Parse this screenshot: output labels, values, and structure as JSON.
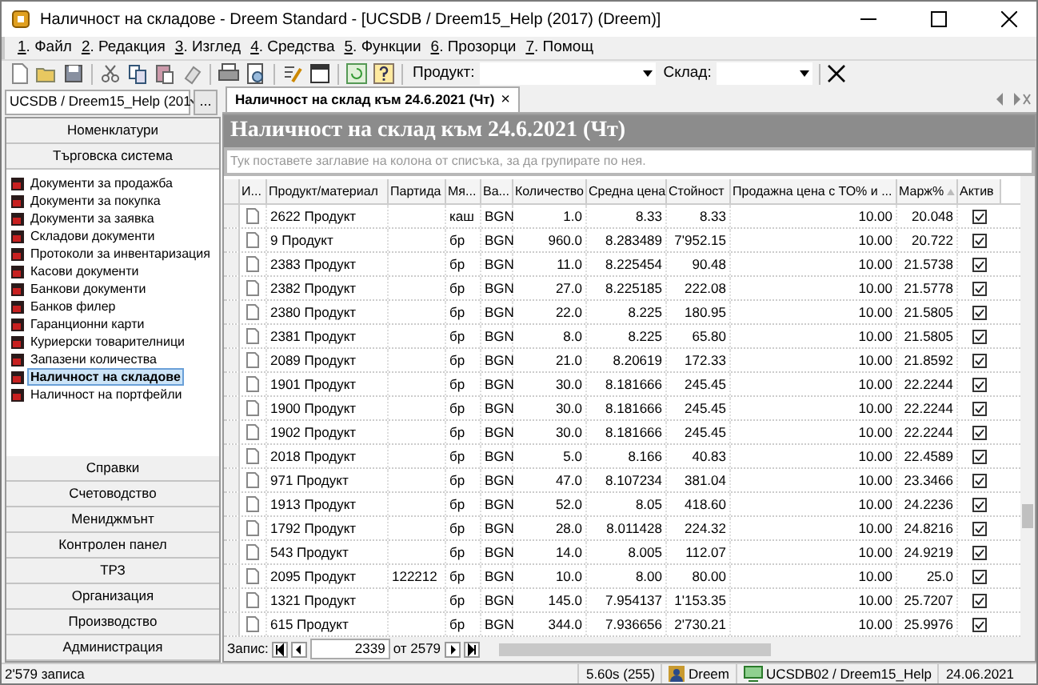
{
  "window": {
    "title": "Наличност на складове - Dreem Standard - [UCSDB / Dreem15_Help (2017) (Dreem)]"
  },
  "menu": [
    {
      "key": "1",
      "label": ". Файл"
    },
    {
      "key": "2",
      "label": ". Редакция"
    },
    {
      "key": "3",
      "label": ". Изглед"
    },
    {
      "key": "4",
      "label": ". Средства"
    },
    {
      "key": "5",
      "label": ". Функции"
    },
    {
      "key": "6",
      "label": ". Прозорци"
    },
    {
      "key": "7",
      "label": ". Помощ"
    }
  ],
  "toolbar": {
    "product_label": "Продукт:",
    "warehouse_label": "Склад:"
  },
  "sidebar": {
    "database": "UCSDB / Dreem15_Help (201",
    "more_button": "...",
    "top_sections": [
      "Номенклатури",
      "Търговска система"
    ],
    "items": [
      {
        "label": "Документи за продажба",
        "selected": false
      },
      {
        "label": "Документи за покупка",
        "selected": false
      },
      {
        "label": "Документи за заявка",
        "selected": false
      },
      {
        "label": "Складови документи",
        "selected": false
      },
      {
        "label": "Протоколи за инвентаризация",
        "selected": false
      },
      {
        "label": "Касови документи",
        "selected": false
      },
      {
        "label": "Банкови документи",
        "selected": false
      },
      {
        "label": "Банков филер",
        "selected": false
      },
      {
        "label": "Гаранционни карти",
        "selected": false
      },
      {
        "label": "Куриерски товарителници",
        "selected": false
      },
      {
        "label": "Запазени количества",
        "selected": false
      },
      {
        "label": "Наличност на складове",
        "selected": true
      },
      {
        "label": "Наличност на портфейли",
        "selected": false
      }
    ],
    "bottom_sections": [
      "Справки",
      "Счетоводство",
      "Мениджмънт",
      "Контролен панел",
      "ТРЗ",
      "Организация",
      "Производство",
      "Администрация"
    ]
  },
  "tab": {
    "label": "Наличност на склад към 24.6.2021 (Чт)",
    "close": "×"
  },
  "report_title": "Наличност на склад към 24.6.2021 (Чт)",
  "group_hint": "Тук поставете заглавие на колона от списъка, за да групирате по нея.",
  "table": {
    "columns": [
      "И...",
      "Продукт/материал",
      "Партида",
      "Мя...",
      "Ва...",
      "Количество",
      "Средна цена",
      "Стойност",
      "Продажна цена с ТО% и ...",
      "Марж%",
      "Актив"
    ],
    "rows": [
      {
        "cells": [
          "",
          "2622 Продукт",
          "",
          "каш",
          "BGN",
          "1.0",
          "8.33",
          "8.33",
          "10.00",
          "20.048"
        ],
        "active": true
      },
      {
        "cells": [
          "",
          "9 Продукт",
          "",
          "бр",
          "BGN",
          "960.0",
          "8.283489",
          "7'952.15",
          "10.00",
          "20.722"
        ],
        "active": true
      },
      {
        "cells": [
          "",
          "2383 Продукт",
          "",
          "бр",
          "BGN",
          "11.0",
          "8.225454",
          "90.48",
          "10.00",
          "21.5738"
        ],
        "active": true
      },
      {
        "cells": [
          "",
          "2382 Продукт",
          "",
          "бр",
          "BGN",
          "27.0",
          "8.225185",
          "222.08",
          "10.00",
          "21.5778"
        ],
        "active": true
      },
      {
        "cells": [
          "",
          "2380 Продукт",
          "",
          "бр",
          "BGN",
          "22.0",
          "8.225",
          "180.95",
          "10.00",
          "21.5805"
        ],
        "active": true
      },
      {
        "cells": [
          "",
          "2381 Продукт",
          "",
          "бр",
          "BGN",
          "8.0",
          "8.225",
          "65.80",
          "10.00",
          "21.5805"
        ],
        "active": true
      },
      {
        "cells": [
          "",
          "2089 Продукт",
          "",
          "бр",
          "BGN",
          "21.0",
          "8.20619",
          "172.33",
          "10.00",
          "21.8592"
        ],
        "active": true
      },
      {
        "cells": [
          "",
          "1901 Продукт",
          "",
          "бр",
          "BGN",
          "30.0",
          "8.181666",
          "245.45",
          "10.00",
          "22.2244"
        ],
        "active": true
      },
      {
        "cells": [
          "",
          "1900 Продукт",
          "",
          "бр",
          "BGN",
          "30.0",
          "8.181666",
          "245.45",
          "10.00",
          "22.2244"
        ],
        "active": true
      },
      {
        "cells": [
          "",
          "1902 Продукт",
          "",
          "бр",
          "BGN",
          "30.0",
          "8.181666",
          "245.45",
          "10.00",
          "22.2244"
        ],
        "active": true
      },
      {
        "cells": [
          "",
          "2018 Продукт",
          "",
          "бр",
          "BGN",
          "5.0",
          "8.166",
          "40.83",
          "10.00",
          "22.4589"
        ],
        "active": true
      },
      {
        "cells": [
          "",
          "971 Продукт",
          "",
          "бр",
          "BGN",
          "47.0",
          "8.107234",
          "381.04",
          "10.00",
          "23.3466"
        ],
        "active": true
      },
      {
        "cells": [
          "",
          "1913 Продукт",
          "",
          "бр",
          "BGN",
          "52.0",
          "8.05",
          "418.60",
          "10.00",
          "24.2236"
        ],
        "active": true
      },
      {
        "cells": [
          "",
          "1792 Продукт",
          "",
          "бр",
          "BGN",
          "28.0",
          "8.011428",
          "224.32",
          "10.00",
          "24.8216"
        ],
        "active": true
      },
      {
        "cells": [
          "",
          "543 Продукт",
          "",
          "бр",
          "BGN",
          "14.0",
          "8.005",
          "112.07",
          "10.00",
          "24.9219"
        ],
        "active": true
      },
      {
        "cells": [
          "",
          "2095 Продукт",
          "122212",
          "бр",
          "BGN",
          "10.0",
          "8.00",
          "80.00",
          "10.00",
          "25.0"
        ],
        "active": true
      },
      {
        "cells": [
          "",
          "1321 Продукт",
          "",
          "бр",
          "BGN",
          "145.0",
          "7.954137",
          "1'153.35",
          "10.00",
          "25.7207"
        ],
        "active": true
      },
      {
        "cells": [
          "",
          "615 Продукт",
          "",
          "бр",
          "BGN",
          "344.0",
          "7.936656",
          "2'730.21",
          "10.00",
          "25.9976"
        ],
        "active": true
      }
    ]
  },
  "navigator": {
    "label": "Запис:",
    "record": "2339",
    "of": "от 2579"
  },
  "status_bar": {
    "records": "2'579 записа",
    "timing": "5.60s (255)",
    "user": "Dreem",
    "connection": "UCSDB02 / Dreem15_Help",
    "date": "24.06.2021"
  }
}
